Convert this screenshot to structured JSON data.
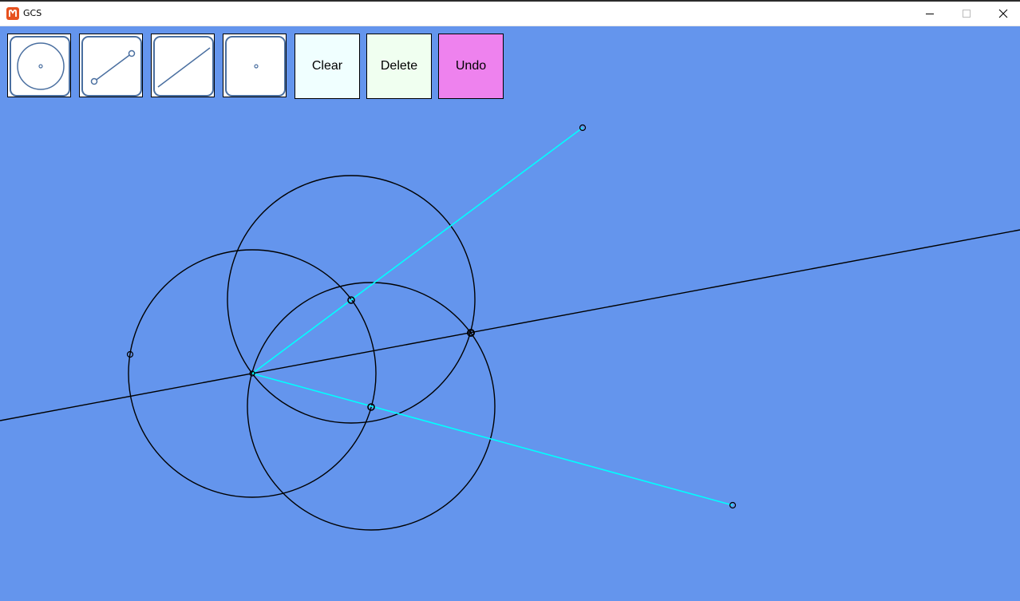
{
  "window": {
    "title": "GCS",
    "controls": [
      "minimize-icon",
      "maximize-icon",
      "close-icon"
    ]
  },
  "toolbar": {
    "tools": [
      {
        "name": "circle-tool",
        "icon": "circle-with-center-icon"
      },
      {
        "name": "segment-tool",
        "icon": "segment-icon"
      },
      {
        "name": "line-tool",
        "icon": "line-icon"
      },
      {
        "name": "point-tool",
        "icon": "point-icon"
      }
    ],
    "clear_label": "Clear",
    "delete_label": "Delete",
    "undo_label": "Undo"
  },
  "colors": {
    "canvas_background": "#6495ED",
    "clear_button": "#F0FFFF",
    "delete_button": "#F0FFF0",
    "undo_button": "#EE82EE",
    "segment_color": "#00FFFF",
    "construction_color": "#000000",
    "tool_icon_color": "#4A6FA0"
  }
}
